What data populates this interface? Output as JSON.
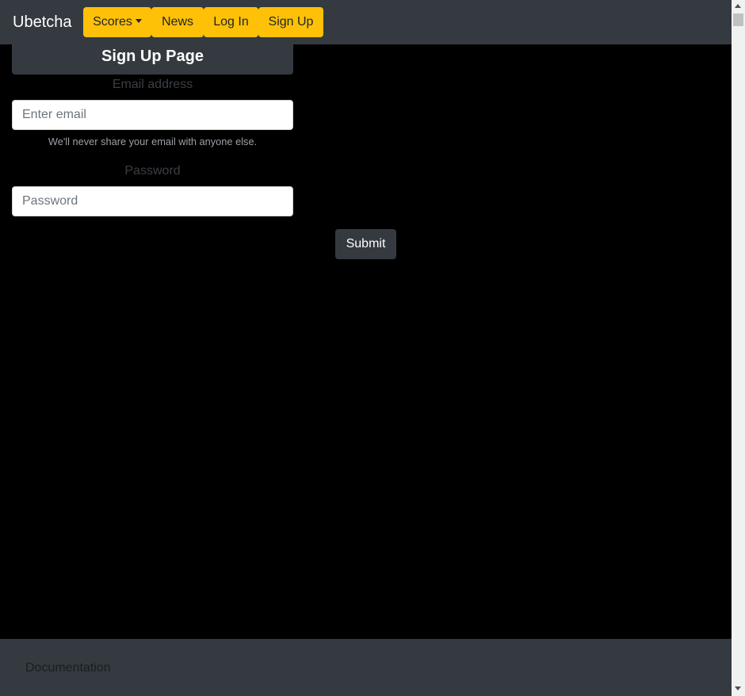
{
  "navbar": {
    "brand": "Ubetcha",
    "items": [
      {
        "label": "Scores",
        "dropdown": true
      },
      {
        "label": "News"
      },
      {
        "label": "Log In"
      },
      {
        "label": "Sign Up"
      }
    ]
  },
  "form": {
    "title": "Sign Up Page",
    "email_label": "Email address",
    "email_placeholder": "Enter email",
    "email_help": "We'll never share your email with anyone else.",
    "password_label": "Password",
    "password_placeholder": "Password",
    "submit_label": "Submit"
  },
  "footer": {
    "link": "Documentation"
  },
  "colors": {
    "navbar_bg": "#343a40",
    "nav_button": "#ffc107",
    "page_bg": "#000000"
  }
}
